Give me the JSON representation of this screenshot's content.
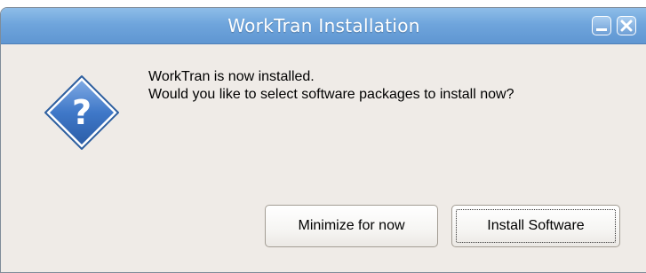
{
  "window": {
    "title": "WorkTran Installation",
    "controls": {
      "minimize_icon": "minimize-icon",
      "close_icon": "close-icon"
    }
  },
  "dialog": {
    "icon": "question-icon",
    "icon_glyph": "?",
    "message_line1": "WorkTran is now installed.",
    "message_line2": "Would you like to select software packages to install now?"
  },
  "buttons": {
    "minimize_label": "Minimize for now",
    "install_label": "Install Software"
  },
  "colors": {
    "titlebar": "#6fa5dc",
    "dialog_bg": "#efebe7",
    "icon_fill": "#3d77c9"
  }
}
